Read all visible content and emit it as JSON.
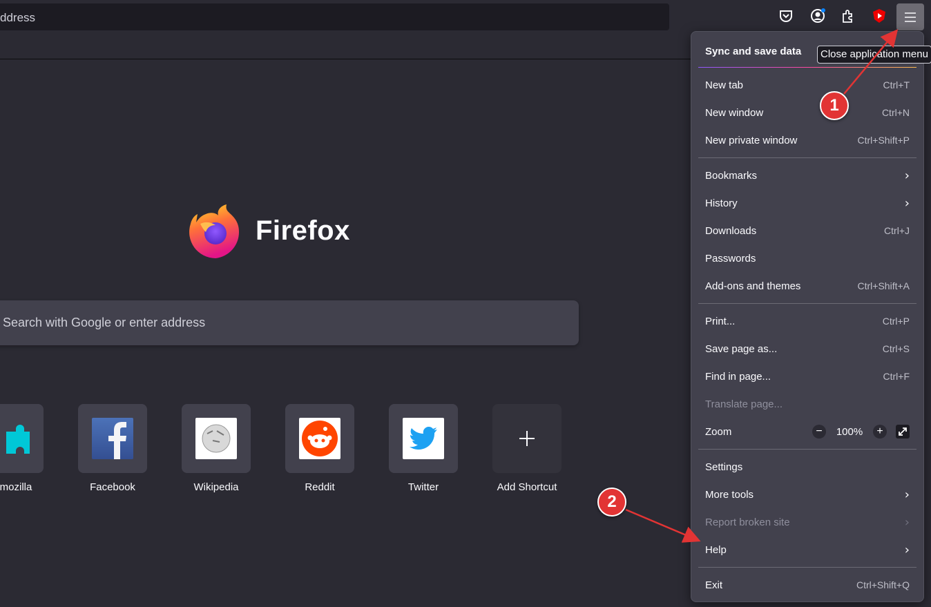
{
  "toolbar": {
    "url_text": "ddress",
    "tooltip": "Close application menu"
  },
  "home": {
    "brand": "Firefox",
    "search_placeholder": "Search with Google or enter address",
    "shortcuts": [
      {
        "label": "ns.mozilla"
      },
      {
        "label": "Facebook"
      },
      {
        "label": "Wikipedia"
      },
      {
        "label": "Reddit"
      },
      {
        "label": "Twitter"
      },
      {
        "label": "Add Shortcut"
      }
    ]
  },
  "menu": {
    "sync": "Sync and save data",
    "new_tab": {
      "label": "New tab",
      "shortcut": "Ctrl+T"
    },
    "new_window": {
      "label": "New window",
      "shortcut": "Ctrl+N"
    },
    "private": {
      "label": "New private window",
      "shortcut": "Ctrl+Shift+P"
    },
    "bookmarks": {
      "label": "Bookmarks"
    },
    "history": {
      "label": "History"
    },
    "downloads": {
      "label": "Downloads",
      "shortcut": "Ctrl+J"
    },
    "passwords": {
      "label": "Passwords"
    },
    "addons": {
      "label": "Add-ons and themes",
      "shortcut": "Ctrl+Shift+A"
    },
    "print": {
      "label": "Print...",
      "shortcut": "Ctrl+P"
    },
    "save": {
      "label": "Save page as...",
      "shortcut": "Ctrl+S"
    },
    "find": {
      "label": "Find in page...",
      "shortcut": "Ctrl+F"
    },
    "translate": {
      "label": "Translate page..."
    },
    "zoom": {
      "label": "Zoom",
      "value": "100%",
      "minus": "−",
      "plus": "+"
    },
    "settings": {
      "label": "Settings"
    },
    "more_tools": {
      "label": "More tools"
    },
    "report": {
      "label": "Report broken site"
    },
    "help": {
      "label": "Help"
    },
    "exit": {
      "label": "Exit",
      "shortcut": "Ctrl+Shift+Q"
    }
  },
  "annotations": {
    "one": "1",
    "two": "2",
    "color": "#e23434"
  }
}
